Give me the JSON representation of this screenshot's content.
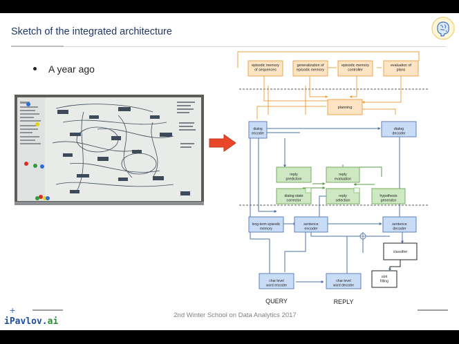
{
  "slide": {
    "title": "Sketch of the integrated architecture",
    "bullet": "A year ago",
    "footer": "2nd Winter School on Data Analytics 2017",
    "brand_main": "iPavlov.",
    "brand_ai": "ai",
    "plus": "+"
  },
  "diagram": {
    "top_row": [
      "episodic memory of sequences",
      "generalization of episodic memory",
      "episodic memory controller",
      "evaluation of plans"
    ],
    "planning": "planning",
    "dialog_encoder": "dialog encoder",
    "dialog_decoder": "dialog decoder",
    "reply_prediction": "reply prediction",
    "reply_evaluation": "reply evaluation",
    "dialog_state_corrector": "dialog state corrector",
    "reply_selection": "reply selection",
    "hypothesis_generator": "hypothesis generator",
    "long_term": "long-term episodic memory",
    "sentence_encoder": "sentence encoder",
    "sentence_decoder": "sentence decoder",
    "classifier": "classifier",
    "slot_filling": "slot filling",
    "char_encoder": "char level word encoder",
    "char_decoder": "char level word decoder",
    "query": "QUERY",
    "reply": "REPLY"
  },
  "colors": {
    "orange_fill": "#fde4c4",
    "orange_stroke": "#f0a34a",
    "blue_fill": "#c9dcf5",
    "blue_stroke": "#5b7fbd",
    "green_fill": "#cfe8c4",
    "green_stroke": "#79ad63",
    "arrow_red": "#e8472a"
  }
}
